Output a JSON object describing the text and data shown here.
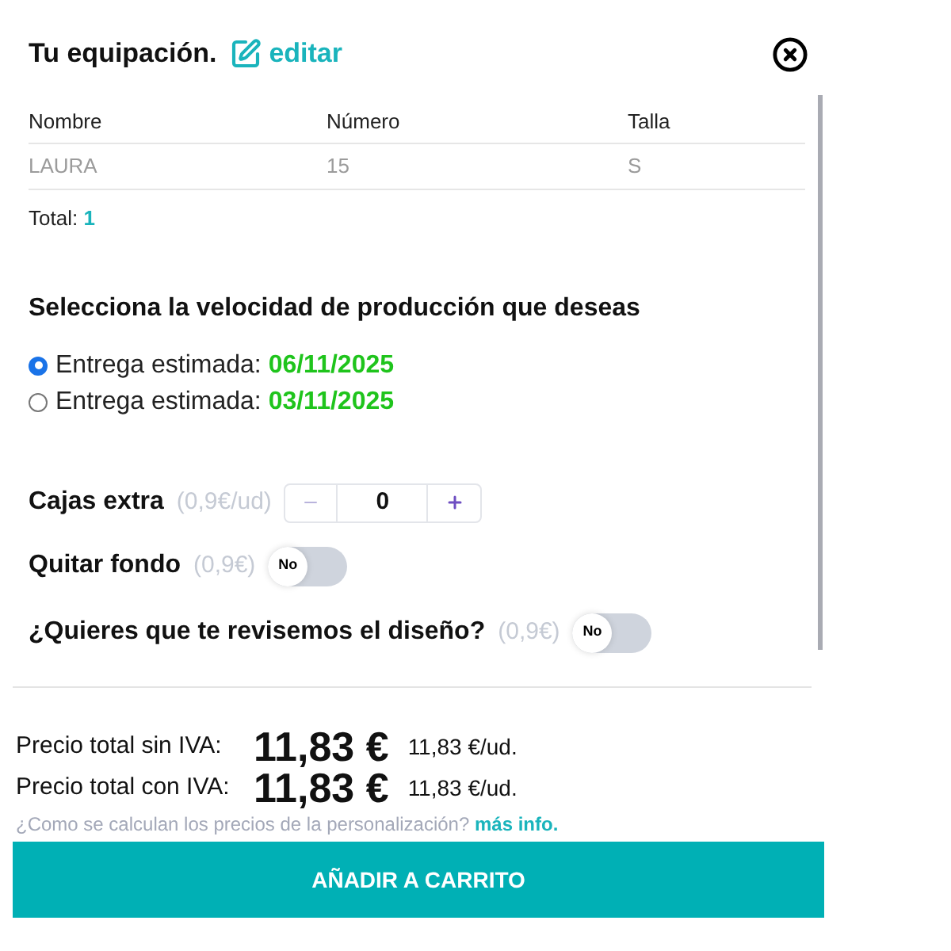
{
  "header": {
    "title": "Tu equipación.",
    "edit_link": "editar"
  },
  "table": {
    "columns": [
      "Nombre",
      "Número",
      "Talla"
    ],
    "rows": [
      [
        "LAURA",
        "15",
        "S"
      ]
    ]
  },
  "total": {
    "label": "Total:",
    "value": "1"
  },
  "production": {
    "title": "Selecciona la velocidad de producción que deseas",
    "options": [
      {
        "label": "Entrega estimada:",
        "date": "06/11/2025",
        "selected": true
      },
      {
        "label": "Entrega estimada:",
        "date": "03/11/2025",
        "selected": false
      }
    ]
  },
  "extras": [
    {
      "kind": "stepper",
      "label": "Cajas extra",
      "price": "(0,9€/ud)",
      "value": "0"
    },
    {
      "kind": "toggle",
      "label": "Quitar fondo",
      "price": "(0,9€)",
      "on": false,
      "state_label": "No"
    },
    {
      "kind": "toggle",
      "label": "¿Quieres que te revisemos el diseño?",
      "price": "(0,9€)",
      "on": false,
      "state_label": "No"
    }
  ],
  "prices": [
    {
      "label": "Precio total sin IVA:",
      "total": "11,83 €",
      "unit": "11,83 €/ud."
    },
    {
      "label": "Precio total con IVA:",
      "total": "11,83 €",
      "unit": "11,83 €/ud."
    }
  ],
  "info": {
    "text": "¿Como se calculan los precios de la personalización?",
    "link": "más info."
  },
  "add_to_cart_button": "AÑADIR A CARRITO"
}
